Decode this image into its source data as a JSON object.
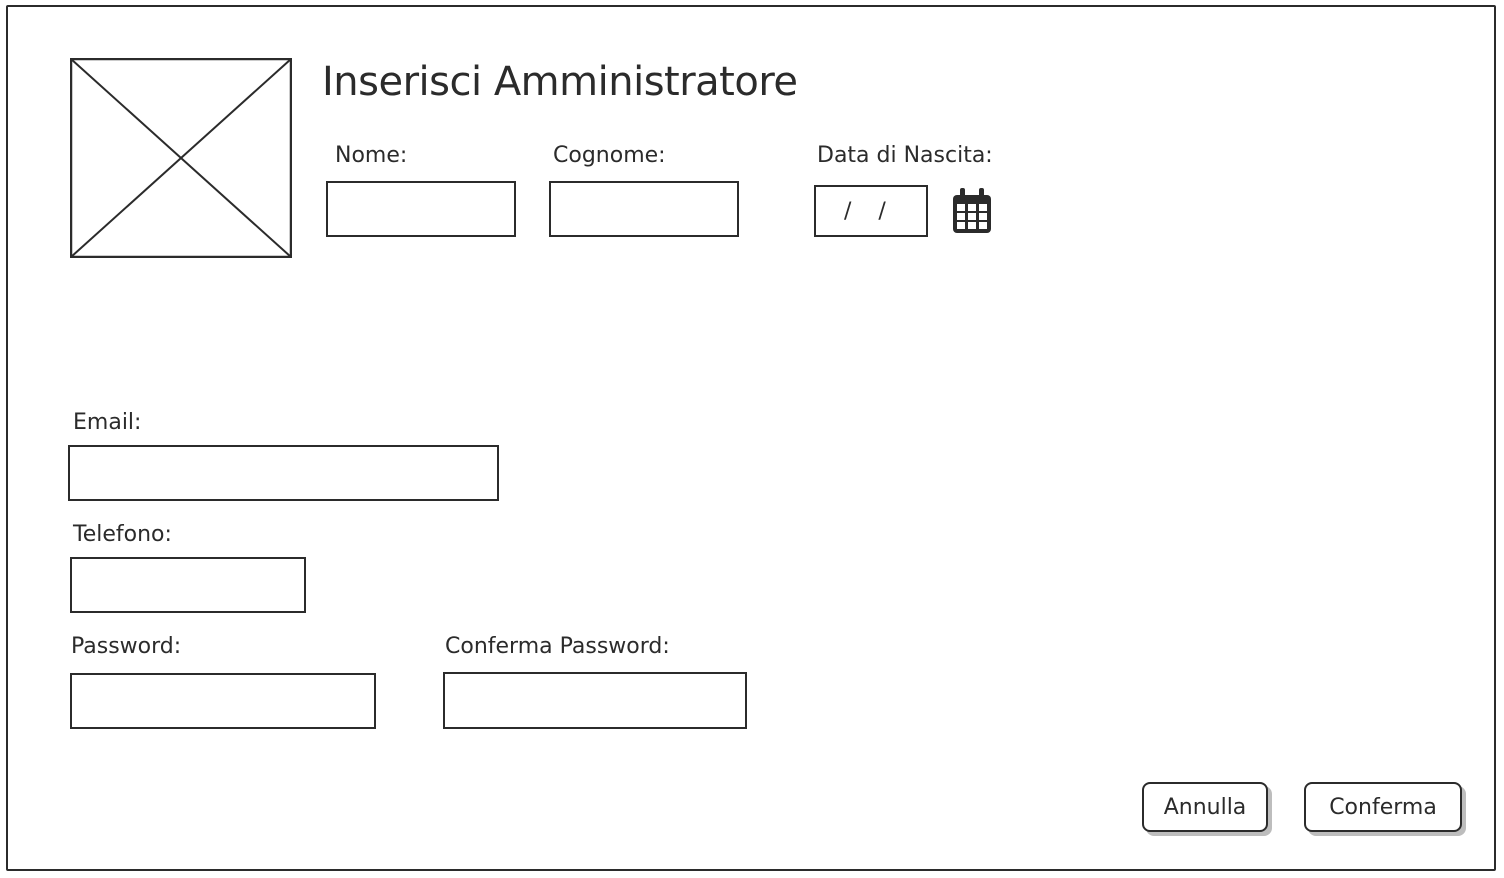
{
  "form": {
    "title": "Inserisci Amministratore",
    "fields": {
      "nome": {
        "label": "Nome:",
        "value": ""
      },
      "cognome": {
        "label": "Cognome:",
        "value": ""
      },
      "data_nascita": {
        "label": "Data di Nascita:",
        "value": "/ /"
      },
      "email": {
        "label": "Email:",
        "value": ""
      },
      "telefono": {
        "label": "Telefono:",
        "value": ""
      },
      "password": {
        "label": "Password:",
        "value": ""
      },
      "conferma_password": {
        "label": "Conferma Password:",
        "value": ""
      }
    },
    "buttons": {
      "annulla": "Annulla",
      "conferma": "Conferma"
    }
  },
  "icons": {
    "image_placeholder": "image-placeholder-icon",
    "calendar": "calendar-icon"
  },
  "colors": {
    "stroke": "#2b2b2b",
    "shadow": "#bdbdbd",
    "background": "#ffffff"
  }
}
